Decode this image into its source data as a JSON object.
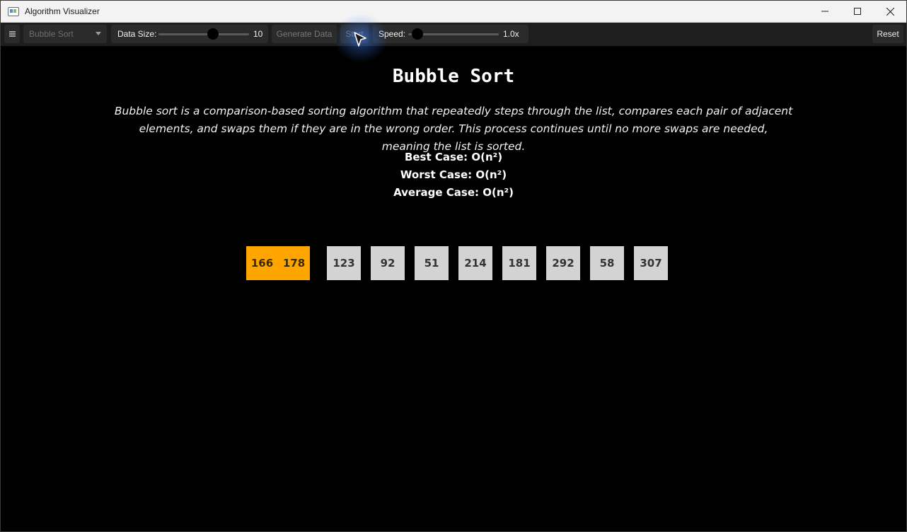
{
  "window": {
    "title": "Algorithm Visualizer"
  },
  "toolbar": {
    "menu_icon": "hamburger-icon",
    "algorithm_selected": "Bubble Sort",
    "data_size_label": "Data Size:",
    "data_size_value": "10",
    "data_size_fraction": 0.6,
    "generate_label": "Generate Data",
    "start_label": "Start",
    "speed_label": "Speed:",
    "speed_value": "1.0x",
    "speed_fraction": 0.1,
    "reset_label": "Reset"
  },
  "content": {
    "title": "Bubble Sort",
    "description": "Bubble sort is a comparison-based sorting algorithm that repeatedly steps through the list, compares each pair of adjacent elements, and swaps them if they are in the wrong order. This process continues until no more swaps are needed, meaning the list is sorted.",
    "best_case": "Best Case: O(n²)",
    "worst_case": "Worst Case: O(n²)",
    "average_case": "Average Case: O(n²)"
  },
  "array": [
    {
      "value": "166",
      "state": "active"
    },
    {
      "value": "178",
      "state": "active"
    },
    {
      "value": "123",
      "state": "normal"
    },
    {
      "value": "92",
      "state": "normal"
    },
    {
      "value": "51",
      "state": "normal"
    },
    {
      "value": "214",
      "state": "normal"
    },
    {
      "value": "181",
      "state": "normal"
    },
    {
      "value": "292",
      "state": "normal"
    },
    {
      "value": "58",
      "state": "normal"
    },
    {
      "value": "307",
      "state": "normal"
    }
  ],
  "colors": {
    "active": "#ffa500",
    "normal": "#d3d3d3"
  }
}
